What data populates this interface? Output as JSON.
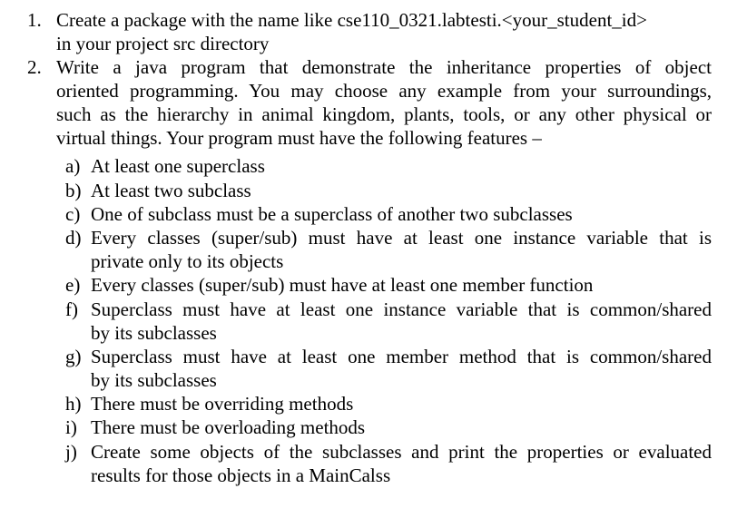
{
  "document": {
    "items": [
      {
        "marker": "1.",
        "lines": [
          "Create a package with the name like cse110_0321.labtesti.<your_student_id>",
          "in your project src directory"
        ]
      },
      {
        "marker": "2.",
        "lines": [
          "Write a java program that demonstrate the inheritance properties of object",
          "oriented programming. You may choose any example from your surroundings,",
          "such as the hierarchy in animal kingdom, plants, tools, or any other physical or",
          "virtual things. Your program must have the following features –"
        ],
        "subitems": [
          {
            "marker": "a)",
            "lines": [
              "At least one superclass"
            ]
          },
          {
            "marker": "b)",
            "lines": [
              "At least two subclass"
            ]
          },
          {
            "marker": "c)",
            "lines": [
              "One of subclass must be a superclass of another two subclasses"
            ]
          },
          {
            "marker": "d)",
            "lines": [
              "Every classes (super/sub) must have at least one instance variable that is",
              "private only to its objects"
            ]
          },
          {
            "marker": "e)",
            "lines": [
              "Every classes (super/sub) must have at least one member function"
            ]
          },
          {
            "marker": "f)",
            "lines": [
              "Superclass must have at least one instance variable that is common/shared",
              "by its subclasses"
            ]
          },
          {
            "marker": "g)",
            "lines": [
              "Superclass must have at least one member method that is common/shared",
              "by its subclasses"
            ]
          },
          {
            "marker": "h)",
            "lines": [
              "There must be overriding methods"
            ]
          },
          {
            "marker": "i)",
            "lines": [
              "There must be overloading methods"
            ]
          },
          {
            "marker": "j)",
            "lines": [
              "Create some objects of the subclasses and print the properties or evaluated",
              "results for those objects in a MainCalss"
            ]
          }
        ]
      }
    ]
  }
}
